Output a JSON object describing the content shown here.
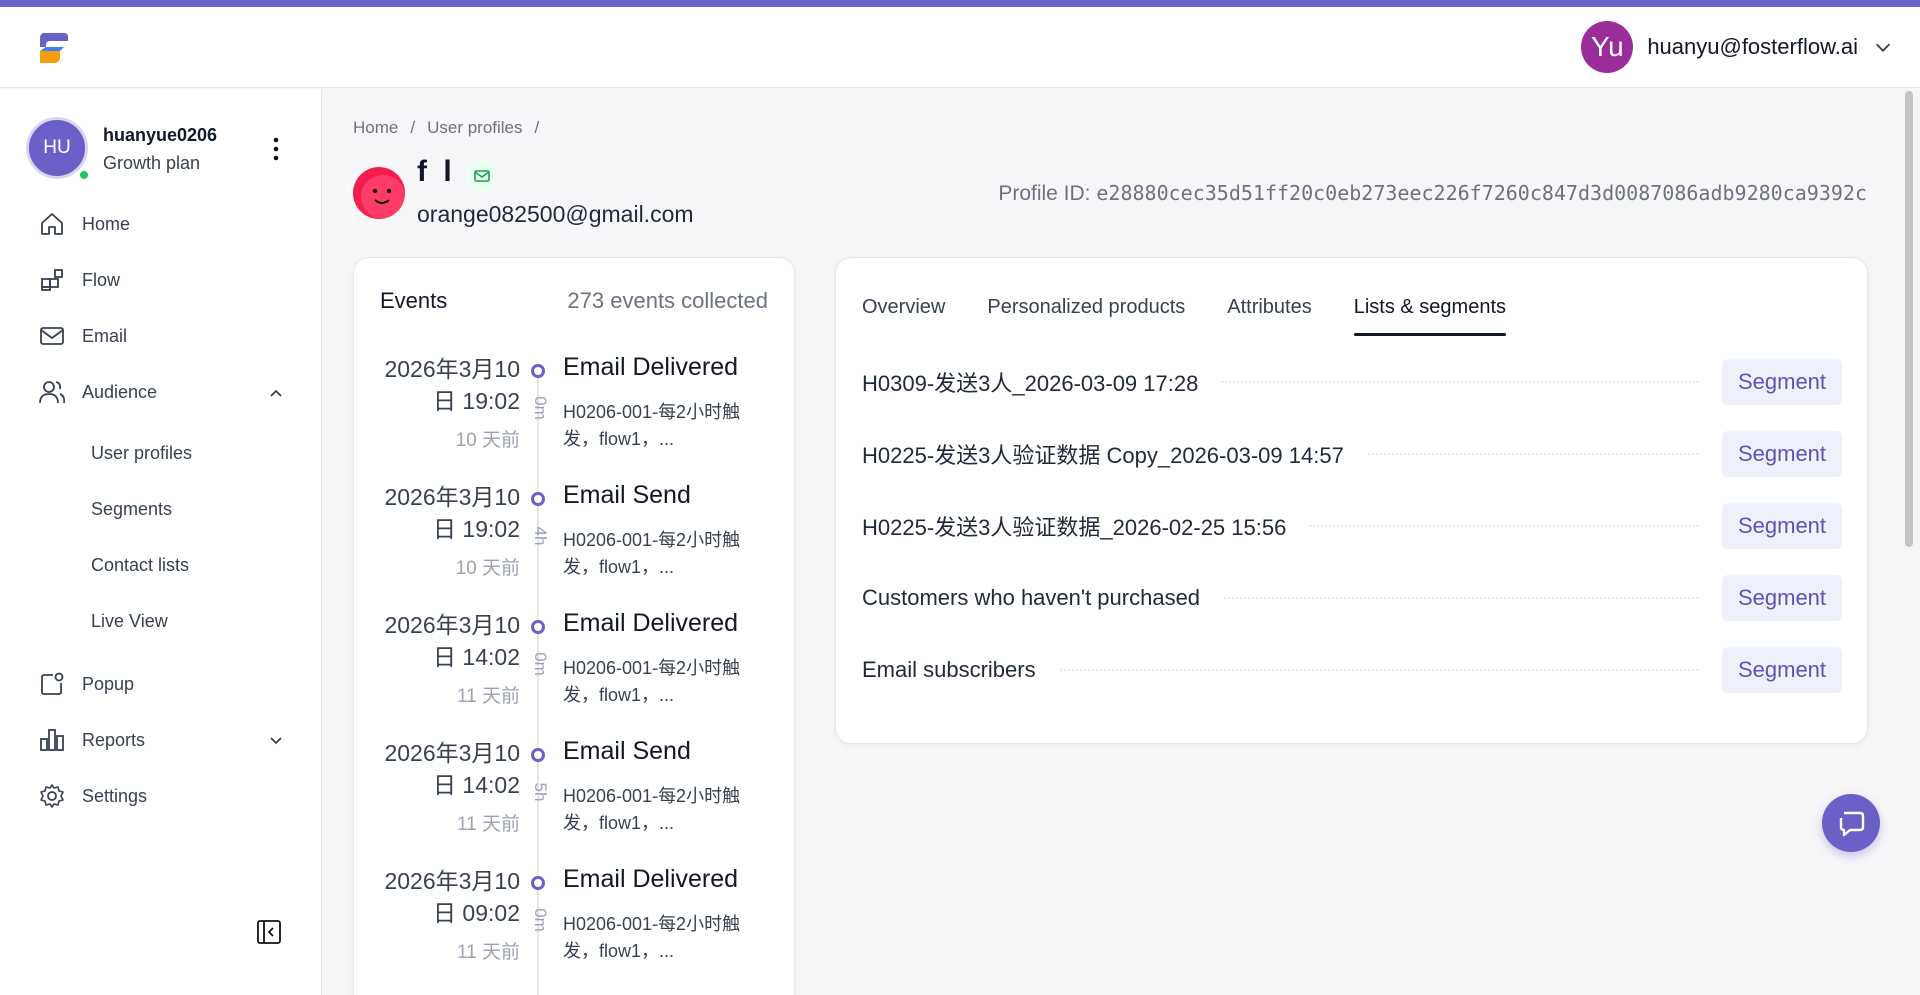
{
  "header": {
    "user_initials": "Yu",
    "user_email": "huanyu@fosterflow.ai"
  },
  "sidebar": {
    "account": {
      "initials": "HU",
      "name": "huanyue0206",
      "plan": "Growth plan"
    },
    "items": [
      {
        "label": "Home",
        "icon": "home-icon"
      },
      {
        "label": "Flow",
        "icon": "flow-icon"
      },
      {
        "label": "Email",
        "icon": "mail-icon"
      },
      {
        "label": "Audience",
        "icon": "users-icon"
      },
      {
        "label": "Popup",
        "icon": "popup-icon"
      },
      {
        "label": "Reports",
        "icon": "bar-chart-icon"
      },
      {
        "label": "Settings",
        "icon": "gear-icon"
      }
    ],
    "audience_sub": [
      "User profiles",
      "Segments",
      "Contact lists",
      "Live View"
    ]
  },
  "breadcrumb": {
    "home": "Home",
    "sep": "/",
    "profiles": "User profiles"
  },
  "profile": {
    "name": "f l",
    "email": "orange082500@gmail.com",
    "id_label": "Profile ID:",
    "id_value": "e28880cec35d51ff20c0eb273eec226f7260c847d3d0087086adb9280ca9392c"
  },
  "events": {
    "title": "Events",
    "count": "273 events collected",
    "items": [
      {
        "date1": "2026年3月10",
        "date2": "日 19:02",
        "ago": "10 天前",
        "duration": "0m",
        "title": "Email Delivered",
        "desc": "H0206-001-每2小时触发，flow1，..."
      },
      {
        "date1": "2026年3月10",
        "date2": "日 19:02",
        "ago": "10 天前",
        "duration": "4h",
        "title": "Email Send",
        "desc": "H0206-001-每2小时触发，flow1，..."
      },
      {
        "date1": "2026年3月10",
        "date2": "日 14:02",
        "ago": "11 天前",
        "duration": "0m",
        "title": "Email Delivered",
        "desc": "H0206-001-每2小时触发，flow1，..."
      },
      {
        "date1": "2026年3月10",
        "date2": "日 14:02",
        "ago": "11 天前",
        "duration": "5h",
        "title": "Email Send",
        "desc": "H0206-001-每2小时触发，flow1，..."
      },
      {
        "date1": "2026年3月10",
        "date2": "日 09:02",
        "ago": "11 天前",
        "duration": "0m",
        "title": "Email Delivered",
        "desc": "H0206-001-每2小时触发，flow1，..."
      }
    ]
  },
  "tabs": [
    "Overview",
    "Personalized products",
    "Attributes",
    "Lists & segments"
  ],
  "active_tab": "Lists & segments",
  "segments": [
    {
      "name": "H0309-发送3人_2026-03-09 17:28",
      "type": "Segment"
    },
    {
      "name": "H0225-发送3人验证数据 Copy_2026-03-09 14:57",
      "type": "Segment"
    },
    {
      "name": "H0225-发送3人验证数据_2026-02-25 15:56",
      "type": "Segment"
    },
    {
      "name": "Customers who haven't purchased",
      "type": "Segment"
    },
    {
      "name": "Email subscribers",
      "type": "Segment"
    }
  ],
  "colors": {
    "brand": "#6b5fc8",
    "user_avatar": "#9b2d9a",
    "online": "#22c55e",
    "profile_avatar": "#f31d4e",
    "segment_bg": "#eef0fb",
    "segment_text": "#5b55b5"
  }
}
